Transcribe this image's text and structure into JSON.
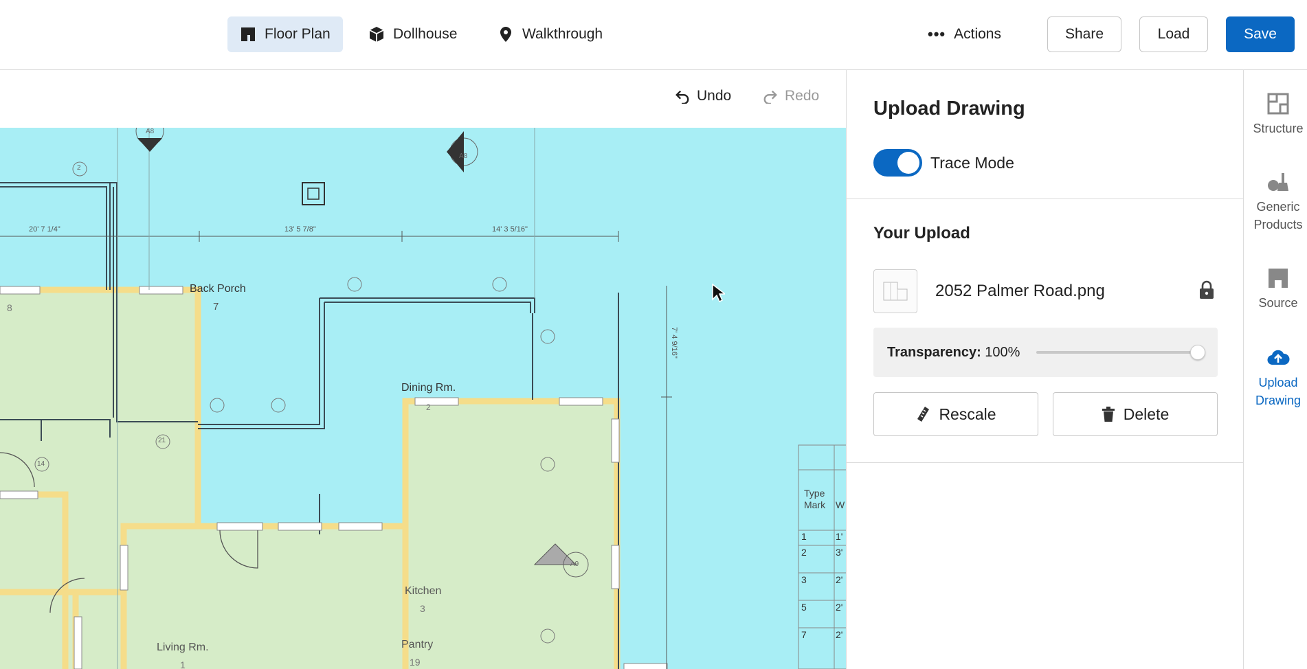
{
  "header": {
    "tabs": [
      {
        "label": "Floor Plan",
        "icon": "floor-plan-icon",
        "active": true
      },
      {
        "label": "Dollhouse",
        "icon": "cube-icon",
        "active": false
      },
      {
        "label": "Walkthrough",
        "icon": "map-pin-icon",
        "active": false
      }
    ],
    "actions_label": "Actions",
    "share_label": "Share",
    "load_label": "Load",
    "save_label": "Save"
  },
  "canvas_toolbar": {
    "undo_label": "Undo",
    "redo_label": "Redo"
  },
  "floor_plan": {
    "room_labels": [
      "Back Porch",
      "Dining Rm.",
      "Kitchen",
      "Living Rm.",
      "Pantry"
    ],
    "room_numbers": [
      "7",
      "8",
      "3",
      "19",
      "1",
      "2"
    ],
    "dimensions": [
      "20' 7 1/4\"",
      "13' 5 7/8\"",
      "14' 3 5/16\"",
      "7' 4 9/16\""
    ],
    "tags": [
      "2",
      "A8",
      "14",
      "21",
      "A9"
    ],
    "schedule": {
      "header_type": "Type",
      "header_mark": "Mark",
      "header_w": "W",
      "rows": [
        [
          "1",
          "1'"
        ],
        [
          "2",
          "3'"
        ],
        [
          "3",
          "2'"
        ],
        [
          "5",
          "2'"
        ],
        [
          "7",
          "2'"
        ]
      ]
    },
    "colors": {
      "background": "#a8eef5",
      "room_fill": "#d6ecc8",
      "wall_trace": "#f5dd8a"
    }
  },
  "panel": {
    "title": "Upload Drawing",
    "trace_mode_label": "Trace Mode",
    "trace_mode_on": true,
    "your_upload_title": "Your Upload",
    "file_name": "2052 Palmer Road.png",
    "transparency_label": "Transparency:",
    "transparency_value": "100%",
    "transparency_level": 1.0,
    "rescale_label": "Rescale",
    "delete_label": "Delete"
  },
  "rail": {
    "items": [
      {
        "label": "Structure",
        "icon": "structure-icon"
      },
      {
        "label": "Generic Products",
        "icon": "products-icon"
      },
      {
        "label": "Source",
        "icon": "source-icon"
      },
      {
        "label": "Upload Drawing",
        "icon": "cloud-upload-icon",
        "active": true
      }
    ]
  },
  "accent_color": "#0b68c2"
}
